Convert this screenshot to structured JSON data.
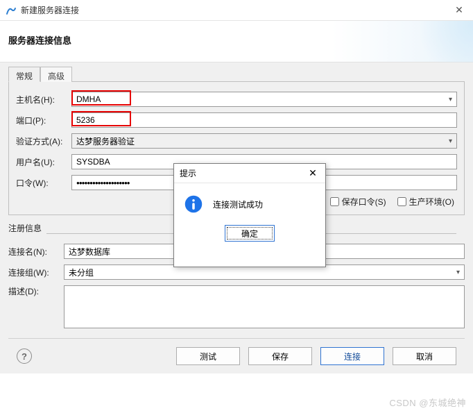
{
  "window": {
    "title": "新建服务器连接",
    "close_glyph": "✕"
  },
  "header": {
    "heading": "服务器连接信息"
  },
  "tabs": {
    "general": "常规",
    "advanced": "高级"
  },
  "form": {
    "host_label": "主机名(H):",
    "host_value": "DMHA",
    "port_label": "端口(P):",
    "port_value": "5236",
    "auth_label": "验证方式(A):",
    "auth_value": "达梦服务器验证",
    "user_label": "用户名(U):",
    "user_value": "SYSDBA",
    "pwd_label": "口令(W):",
    "pwd_value": "●●●●●●●●●●●●●●●●●●●●",
    "save_pwd_label": "保存口令(S)",
    "prod_env_label": "生产环境(O)"
  },
  "reg_group": {
    "title": "注册信息",
    "conn_name_label": "连接名(N):",
    "conn_name_value": "达梦数据库",
    "conn_group_label": "连接组(W):",
    "conn_group_value": "未分组",
    "desc_label": "描述(D):",
    "desc_value": ""
  },
  "buttons": {
    "help_glyph": "?",
    "test": "测试",
    "save": "保存",
    "connect": "连接",
    "cancel": "取消"
  },
  "modal": {
    "title": "提示",
    "message": "连接测试成功",
    "ok": "确定",
    "close_glyph": "✕"
  },
  "watermark": "CSDN @东城绝神"
}
